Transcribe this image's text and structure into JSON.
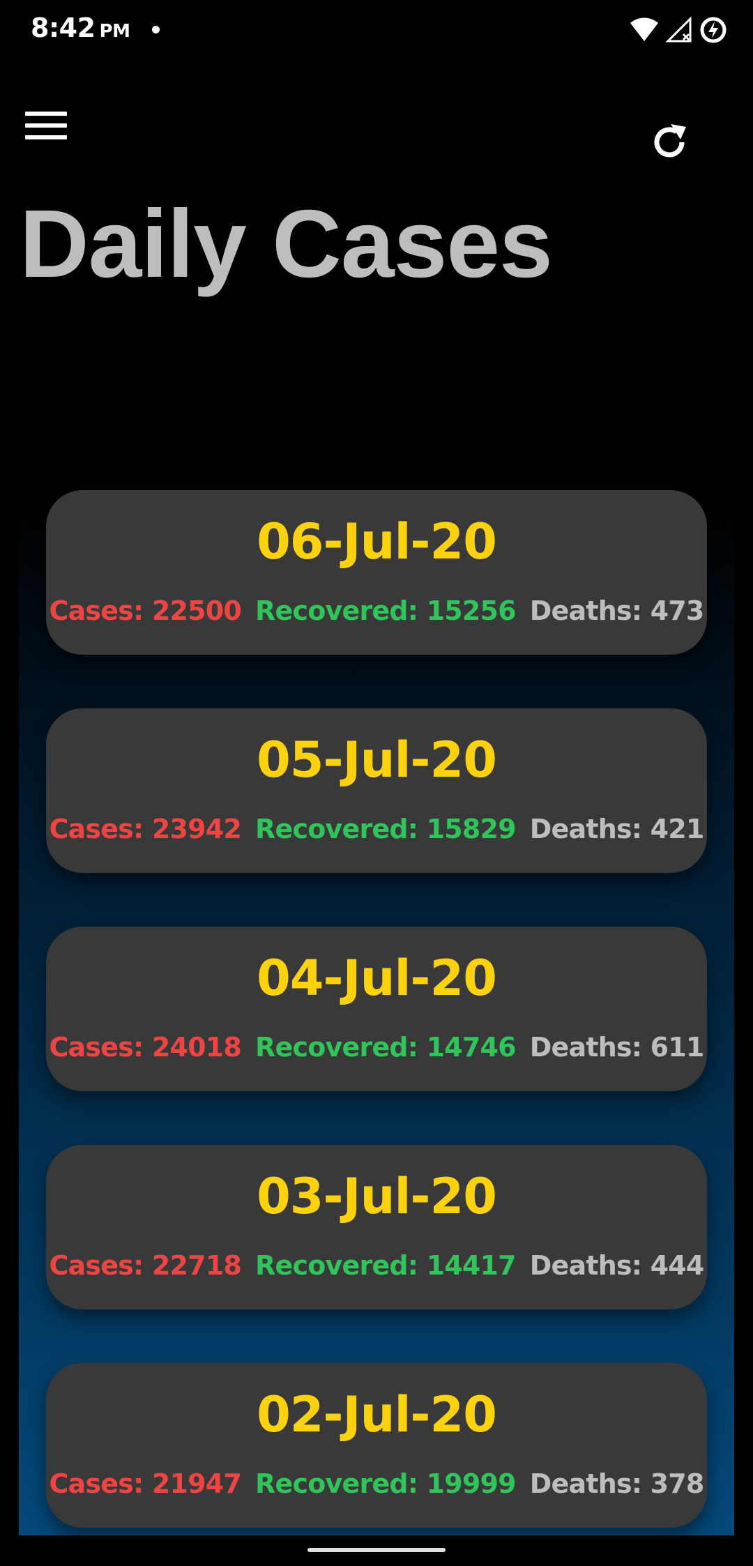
{
  "status_bar": {
    "time": "8:42",
    "ampm": "PM"
  },
  "icons": {
    "menu": "menu-icon",
    "refresh": "refresh-icon",
    "wifi": "wifi-icon",
    "signal": "signal-off-icon",
    "battery": "battery-saver-icon"
  },
  "header": {
    "title": "Daily Cases"
  },
  "colors": {
    "date": "#fcd20f",
    "cases": "#ef4444",
    "recovered": "#2fc55a",
    "deaths": "#bdbdbd",
    "card": "#393939"
  },
  "cards": [
    {
      "date": "06-Jul-20",
      "cases": "Cases: 22500",
      "recovered": "Recovered: 15256",
      "deaths": "Deaths: 473"
    },
    {
      "date": "05-Jul-20",
      "cases": "Cases: 23942",
      "recovered": "Recovered: 15829",
      "deaths": "Deaths: 421"
    },
    {
      "date": "04-Jul-20",
      "cases": "Cases: 24018",
      "recovered": "Recovered: 14746",
      "deaths": "Deaths: 611"
    },
    {
      "date": "03-Jul-20",
      "cases": "Cases: 22718",
      "recovered": "Recovered: 14417",
      "deaths": "Deaths: 444"
    },
    {
      "date": "02-Jul-20",
      "cases": "Cases: 21947",
      "recovered": "Recovered: 19999",
      "deaths": "Deaths: 378"
    }
  ]
}
